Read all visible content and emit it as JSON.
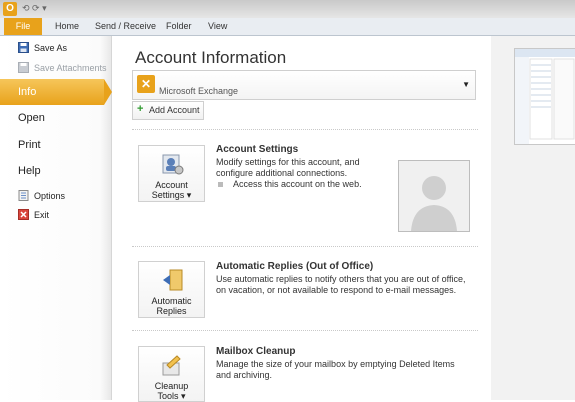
{
  "titlebar": {
    "app_icon": "outlook-icon"
  },
  "tabs": [
    {
      "label": "File"
    },
    {
      "label": "Home"
    },
    {
      "label": "Send / Receive"
    },
    {
      "label": "Folder"
    },
    {
      "label": "View"
    }
  ],
  "nav": {
    "save_as": "Save As",
    "save_attachments": "Save Attachments",
    "info": "Info",
    "open": "Open",
    "print": "Print",
    "help": "Help",
    "options": "Options",
    "exit": "Exit"
  },
  "main": {
    "title": "Account Information",
    "account_selector": {
      "value": "Microsoft Exchange"
    },
    "add_account": "Add Account",
    "account_settings": {
      "button_line1": "Account",
      "button_line2": "Settings",
      "title": "Account Settings",
      "desc": "Modify settings for this account, and configure additional connections.",
      "bullet": "Access this account on the web."
    },
    "auto_replies": {
      "button_line1": "Automatic",
      "button_line2": "Replies",
      "title": "Automatic Replies (Out of Office)",
      "desc": "Use automatic replies to notify others that you are out of office, on vacation, or not available to respond to e-mail messages."
    },
    "cleanup": {
      "button_line1": "Cleanup",
      "button_line2": "Tools",
      "title": "Mailbox Cleanup",
      "desc": "Manage the size of your mailbox by emptying Deleted Items and archiving."
    }
  },
  "colors": {
    "accent": "#e8a21b",
    "tab_bg": "#e9edf2"
  }
}
